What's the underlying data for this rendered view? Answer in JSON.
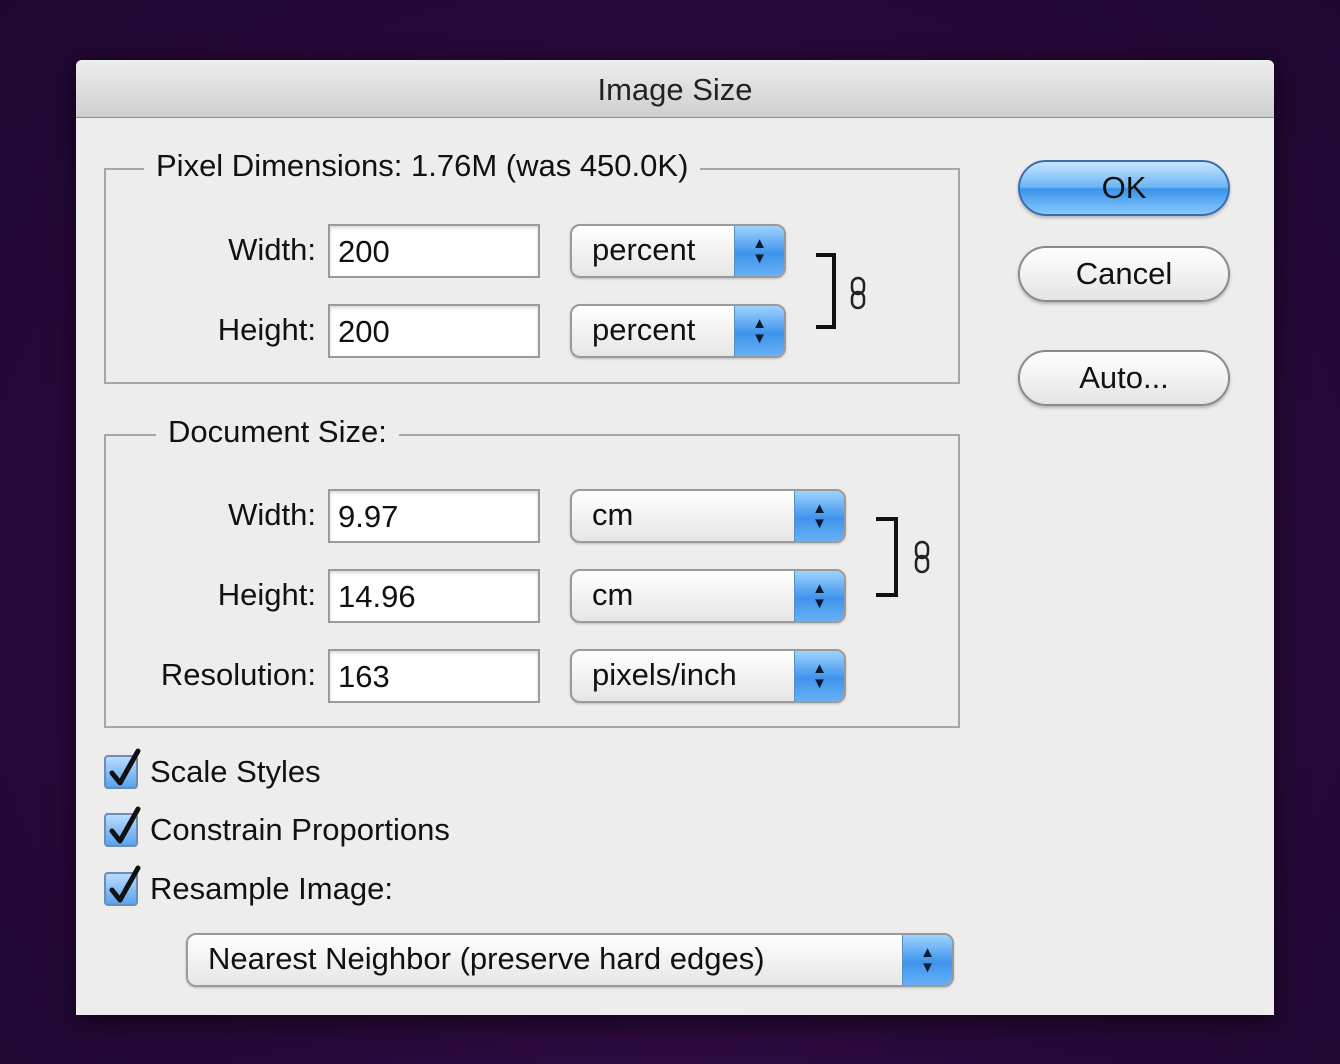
{
  "dialog": {
    "title": "Image Size"
  },
  "pixel_dimensions": {
    "legend": "Pixel Dimensions:  1.76M (was 450.0K)",
    "width_label": "Width:",
    "width_value": "200",
    "width_unit": "percent",
    "height_label": "Height:",
    "height_value": "200",
    "height_unit": "percent",
    "linked": true
  },
  "document_size": {
    "legend": "Document Size:",
    "width_label": "Width:",
    "width_value": "9.97",
    "width_unit": "cm",
    "height_label": "Height:",
    "height_value": "14.96",
    "height_unit": "cm",
    "resolution_label": "Resolution:",
    "resolution_value": "163",
    "resolution_unit": "pixels/inch",
    "linked": true
  },
  "options": {
    "scale_styles_label": "Scale Styles",
    "scale_styles_checked": true,
    "constrain_label": "Constrain Proportions",
    "constrain_checked": true,
    "resample_label": "Resample Image:",
    "resample_checked": true,
    "resample_method": "Nearest Neighbor (preserve hard edges)"
  },
  "buttons": {
    "ok": "OK",
    "cancel": "Cancel",
    "auto": "Auto..."
  },
  "icons": {
    "popup_arrows": "up-down-arrows-icon",
    "link": "chain-link-icon",
    "check": "checkmark-icon"
  },
  "colors": {
    "accent_blue": "#3f94ec",
    "dialog_bg": "#ededed",
    "desktop_bg": "#2c0a3e"
  }
}
